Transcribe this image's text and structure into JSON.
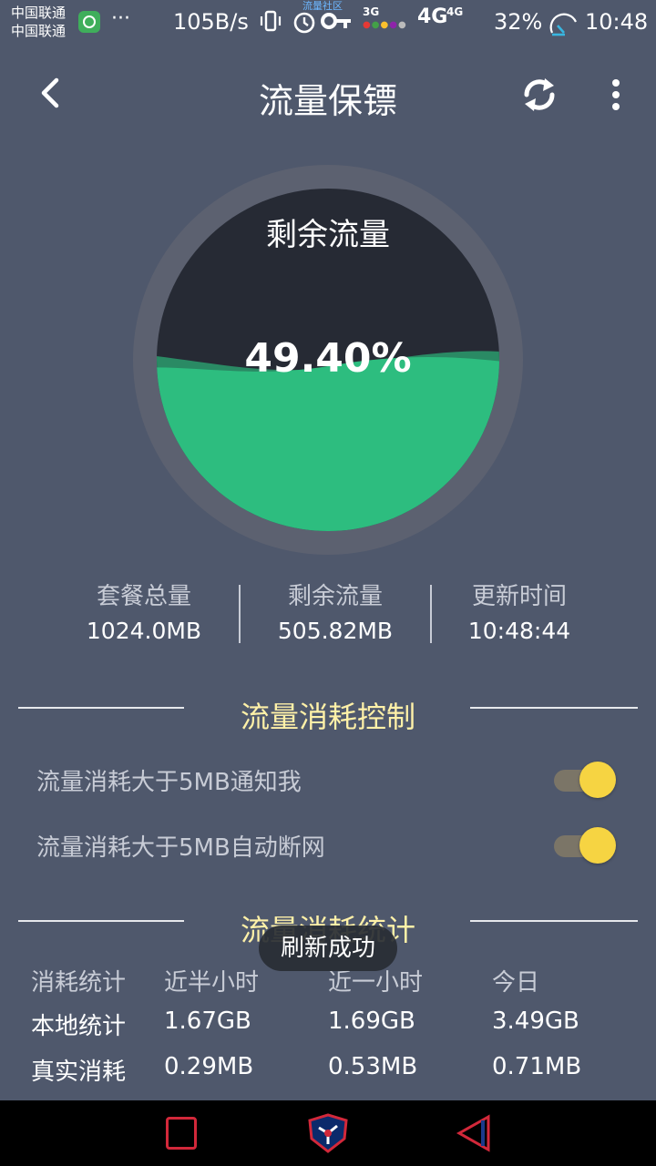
{
  "status_bar": {
    "carrier_1": "中国联通",
    "carrier_2": "中国联通",
    "overflow": "···",
    "net_speed": "105B/s",
    "community_label": "流量社区",
    "net_3g": "3G",
    "net_4g": "4G",
    "net_4g_small": "4G",
    "battery": "32%",
    "time": "10:48",
    "icons": [
      "app-icon",
      "vibrate-icon",
      "alarm-icon",
      "key-icon",
      "signal-icon",
      "speed-gauge-icon"
    ]
  },
  "header": {
    "title": "流量保镖",
    "icons": [
      "back-icon",
      "refresh-icon",
      "more-icon"
    ]
  },
  "gauge": {
    "label": "剩余流量",
    "percent_text": "49.40%",
    "fill_fraction": 0.494,
    "colors": {
      "fill": "#2dbd7f",
      "wave_back": "#2a8a64",
      "empty": "#262a34",
      "ring": "#5c6170"
    }
  },
  "stats": [
    {
      "label": "套餐总量",
      "value": "1024.0MB"
    },
    {
      "label": "剩余流量",
      "value": "505.82MB"
    },
    {
      "label": "更新时间",
      "value": "10:48:44"
    }
  ],
  "control": {
    "title": "流量消耗控制",
    "items": [
      {
        "label": "流量消耗大于5MB通知我",
        "on": true
      },
      {
        "label": "流量消耗大于5MB自动断网",
        "on": true
      }
    ]
  },
  "statistics": {
    "title": "流量消耗统计",
    "headers": [
      "消耗统计",
      "近半小时",
      "近一小时",
      "今日"
    ],
    "rows": [
      {
        "label": "本地统计",
        "values": [
          "1.67GB",
          "1.69GB",
          "3.49GB"
        ]
      },
      {
        "label": "真实消耗",
        "values": [
          "0.29MB",
          "0.53MB",
          "0.71MB"
        ]
      }
    ]
  },
  "toast": {
    "text": "刷新成功"
  },
  "nav_bar": {
    "icons": [
      "recent-apps-icon",
      "home-logo-icon",
      "back-triangle-icon"
    ]
  },
  "colors": {
    "background": "#4f586c",
    "accent_title": "#fff1a8",
    "toggle_knob": "#f6d442"
  }
}
